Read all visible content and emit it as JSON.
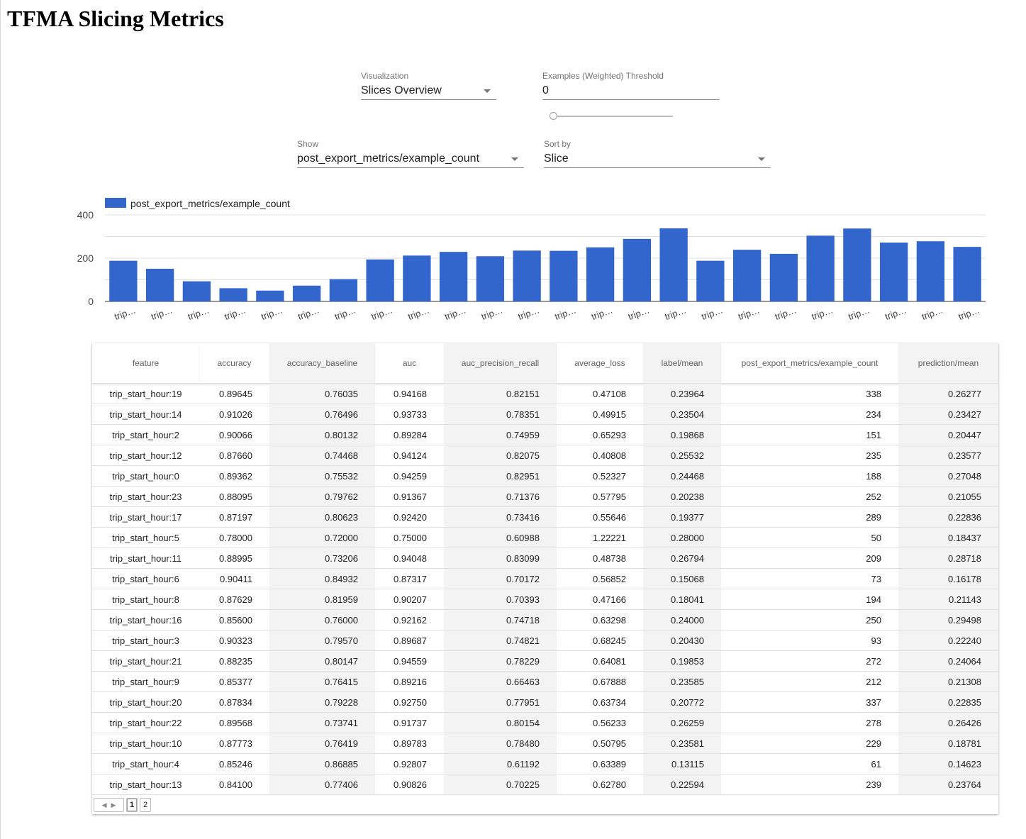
{
  "page": {
    "title": "TFMA Slicing Metrics"
  },
  "controls": {
    "visualization": {
      "label": "Visualization",
      "value": "Slices Overview"
    },
    "threshold": {
      "label": "Examples (Weighted) Threshold",
      "value": "0",
      "slider_value": 0
    },
    "show": {
      "label": "Show",
      "value": "post_export_metrics/example_count"
    },
    "sort_by": {
      "label": "Sort by",
      "value": "Slice"
    }
  },
  "chart_data": {
    "type": "bar",
    "legend": "post_export_metrics/example_count",
    "color": "#3366cc",
    "ylim": [
      0,
      400
    ],
    "yticks": [
      0,
      200,
      400
    ],
    "grid": true,
    "categories": [
      "trip…",
      "trip…",
      "trip…",
      "trip…",
      "trip…",
      "trip…",
      "trip…",
      "trip…",
      "trip…",
      "trip…",
      "trip…",
      "trip…",
      "trip…",
      "trip…",
      "trip…",
      "trip…",
      "trip…",
      "trip…",
      "trip…",
      "trip…",
      "trip…",
      "trip…",
      "trip…",
      "trip…"
    ],
    "values": [
      188,
      151,
      93,
      61,
      50,
      73,
      103,
      194,
      212,
      229,
      209,
      235,
      234,
      250,
      289,
      338,
      188,
      239,
      220,
      304,
      337,
      272,
      278,
      252
    ]
  },
  "table": {
    "columns": [
      "feature",
      "accuracy",
      "accuracy_baseline",
      "auc",
      "auc_precision_recall",
      "average_loss",
      "label/mean",
      "post_export_metrics/example_count",
      "prediction/mean"
    ],
    "rows": [
      [
        "trip_start_hour:19",
        "0.89645",
        "0.76035",
        "0.94168",
        "0.82151",
        "0.47108",
        "0.23964",
        "338",
        "0.26277"
      ],
      [
        "trip_start_hour:14",
        "0.91026",
        "0.76496",
        "0.93733",
        "0.78351",
        "0.49915",
        "0.23504",
        "234",
        "0.23427"
      ],
      [
        "trip_start_hour:2",
        "0.90066",
        "0.80132",
        "0.89284",
        "0.74959",
        "0.65293",
        "0.19868",
        "151",
        "0.20447"
      ],
      [
        "trip_start_hour:12",
        "0.87660",
        "0.74468",
        "0.94124",
        "0.82075",
        "0.40808",
        "0.25532",
        "235",
        "0.23577"
      ],
      [
        "trip_start_hour:0",
        "0.89362",
        "0.75532",
        "0.94259",
        "0.82951",
        "0.52327",
        "0.24468",
        "188",
        "0.27048"
      ],
      [
        "trip_start_hour:23",
        "0.88095",
        "0.79762",
        "0.91367",
        "0.71376",
        "0.57795",
        "0.20238",
        "252",
        "0.21055"
      ],
      [
        "trip_start_hour:17",
        "0.87197",
        "0.80623",
        "0.92420",
        "0.73416",
        "0.55646",
        "0.19377",
        "289",
        "0.22836"
      ],
      [
        "trip_start_hour:5",
        "0.78000",
        "0.72000",
        "0.75000",
        "0.60988",
        "1.22221",
        "0.28000",
        "50",
        "0.18437"
      ],
      [
        "trip_start_hour:11",
        "0.88995",
        "0.73206",
        "0.94048",
        "0.83099",
        "0.48738",
        "0.26794",
        "209",
        "0.28718"
      ],
      [
        "trip_start_hour:6",
        "0.90411",
        "0.84932",
        "0.87317",
        "0.70172",
        "0.56852",
        "0.15068",
        "73",
        "0.16178"
      ],
      [
        "trip_start_hour:8",
        "0.87629",
        "0.81959",
        "0.90207",
        "0.70393",
        "0.47166",
        "0.18041",
        "194",
        "0.21143"
      ],
      [
        "trip_start_hour:16",
        "0.85600",
        "0.76000",
        "0.92162",
        "0.74718",
        "0.63298",
        "0.24000",
        "250",
        "0.29498"
      ],
      [
        "trip_start_hour:3",
        "0.90323",
        "0.79570",
        "0.89687",
        "0.74821",
        "0.68245",
        "0.20430",
        "93",
        "0.22240"
      ],
      [
        "trip_start_hour:21",
        "0.88235",
        "0.80147",
        "0.94559",
        "0.78229",
        "0.64081",
        "0.19853",
        "272",
        "0.24064"
      ],
      [
        "trip_start_hour:9",
        "0.85377",
        "0.76415",
        "0.89216",
        "0.66463",
        "0.67888",
        "0.23585",
        "212",
        "0.21308"
      ],
      [
        "trip_start_hour:20",
        "0.87834",
        "0.79228",
        "0.92750",
        "0.77951",
        "0.63734",
        "0.20772",
        "337",
        "0.22835"
      ],
      [
        "trip_start_hour:22",
        "0.89568",
        "0.73741",
        "0.91737",
        "0.80154",
        "0.56233",
        "0.26259",
        "278",
        "0.26426"
      ],
      [
        "trip_start_hour:10",
        "0.87773",
        "0.76419",
        "0.89783",
        "0.78480",
        "0.50795",
        "0.23581",
        "229",
        "0.18781"
      ],
      [
        "trip_start_hour:4",
        "0.85246",
        "0.86885",
        "0.92807",
        "0.61192",
        "0.63389",
        "0.13115",
        "61",
        "0.14623"
      ],
      [
        "trip_start_hour:13",
        "0.84100",
        "0.77406",
        "0.90826",
        "0.70225",
        "0.62780",
        "0.22594",
        "239",
        "0.23764"
      ]
    ]
  },
  "pager": {
    "prev_icon": "◀",
    "next_icon": "▶",
    "pages": [
      "1",
      "2"
    ],
    "current": "1"
  }
}
